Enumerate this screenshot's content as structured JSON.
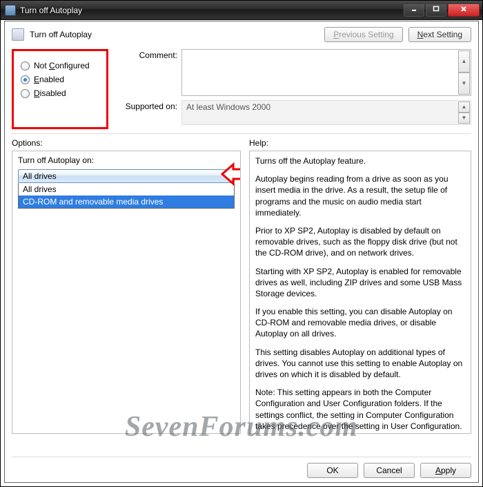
{
  "window": {
    "title": "Turn off Autoplay",
    "heading": "Turn off Autoplay",
    "prev_btn": "Previous Setting",
    "next_btn": "Next Setting"
  },
  "state": {
    "options": [
      {
        "label": "Not Configured",
        "checked": false,
        "underline": "C"
      },
      {
        "label": "Enabled",
        "checked": true,
        "underline": "E"
      },
      {
        "label": "Disabled",
        "checked": false,
        "underline": "D"
      }
    ]
  },
  "labels": {
    "comment": "Comment:",
    "supported": "Supported on:",
    "options": "Options:",
    "help": "Help:"
  },
  "supported_text": "At least Windows 2000",
  "options_pane": {
    "title": "Turn off Autoplay on:",
    "selected": "All drives",
    "items": [
      "All drives",
      "CD-ROM and removable media drives"
    ]
  },
  "help_text": {
    "p1": "Turns off the Autoplay feature.",
    "p2": "Autoplay begins reading from a drive as soon as you insert media in the drive. As a result, the setup file of programs and the music on audio media start immediately.",
    "p3": "Prior to XP SP2, Autoplay is disabled by default on removable drives, such as the floppy disk drive (but not the CD-ROM drive), and on network drives.",
    "p4": "Starting with XP SP2, Autoplay is enabled for removable drives as well, including ZIP drives and some USB Mass Storage devices.",
    "p5": "If you enable this setting, you can disable Autoplay on CD-ROM and removable media drives, or disable Autoplay on all drives.",
    "p6": "This setting disables Autoplay on additional types of drives. You cannot use this setting to enable Autoplay on drives on which it is disabled by default.",
    "p7": "Note: This setting appears in both the Computer Configuration and User Configuration folders. If the settings conflict, the setting in Computer Configuration takes precedence over the setting in User Configuration."
  },
  "footer": {
    "ok": "OK",
    "cancel": "Cancel",
    "apply": "Apply"
  },
  "watermark": "SevenForums.com"
}
